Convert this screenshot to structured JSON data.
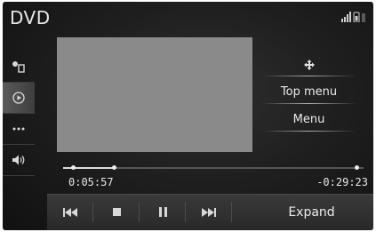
{
  "header": {
    "title": "DVD"
  },
  "status_icons": [
    "signal-strength-icon",
    "phone-battery-icon",
    "network-icon"
  ],
  "sidebar": {
    "items": [
      {
        "icon": "source-select-icon",
        "active": false
      },
      {
        "icon": "play-circle-icon",
        "active": true
      },
      {
        "icon": "more-options-icon",
        "active": false
      },
      {
        "icon": "volume-icon",
        "active": false
      }
    ]
  },
  "right_panel": {
    "move_icon": "four-way-arrows-icon",
    "top_menu_label": "Top menu",
    "menu_label": "Menu"
  },
  "playback": {
    "elapsed": "0:05:57",
    "remaining": "-0:29:23",
    "progress": 0.17
  },
  "controls": {
    "items": [
      "previous-track-icon",
      "stop-icon",
      "pause-icon",
      "next-track-icon"
    ],
    "expand_label": "Expand"
  }
}
